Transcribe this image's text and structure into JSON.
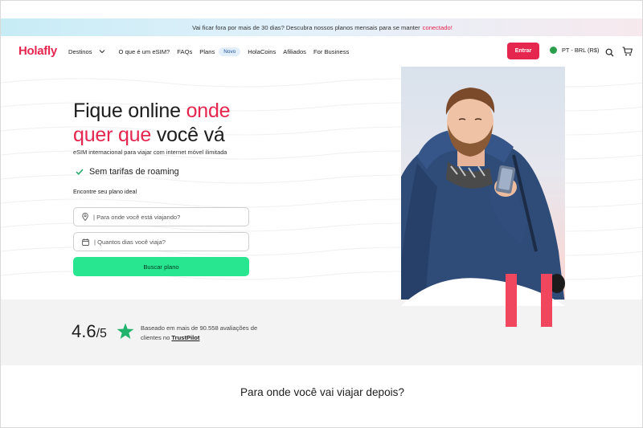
{
  "promo": {
    "text": "Vai ficar fora por mais de 30 dias? Descubra nossos planos mensais para se manter",
    "highlight": "conectado!"
  },
  "nav": {
    "logo": "Holafly",
    "links": {
      "destinos": "Destinos",
      "what_is_esim": "O que é um eSIM?",
      "faqs": "FAQs",
      "plans": "Plans",
      "plans_badge": "Novo",
      "holacoins": "HolaCoins",
      "afiliados": "Afiliados",
      "business": "For Business"
    },
    "login": "Entrar",
    "locale": "PT - BRL (R$)"
  },
  "hero": {
    "title_1": "Fique online ",
    "title_1_accent": "onde",
    "title_2_accent": "quer que",
    "title_2": " você vá",
    "subtitle": "eSIM internacional para viajar com internet móvel ilimitada",
    "feature": "Sem tarifas de roaming",
    "form_label": "Encontre seu plano ideal",
    "destination_placeholder": "Para onde você está viajando?",
    "days_placeholder": "Quantos dias você viaja?",
    "cta": "Buscar plano"
  },
  "rating": {
    "score": "4.6",
    "out_of": "/5",
    "text": "Baseado em mais de 90.558 avaliações de clientes no ",
    "source": "TrustPilot"
  },
  "next_section": {
    "title": "Para onde você vai viajar depois?"
  },
  "colors": {
    "brand": "#e5264f",
    "cta": "#28e58f",
    "star": "#1fb36b"
  }
}
